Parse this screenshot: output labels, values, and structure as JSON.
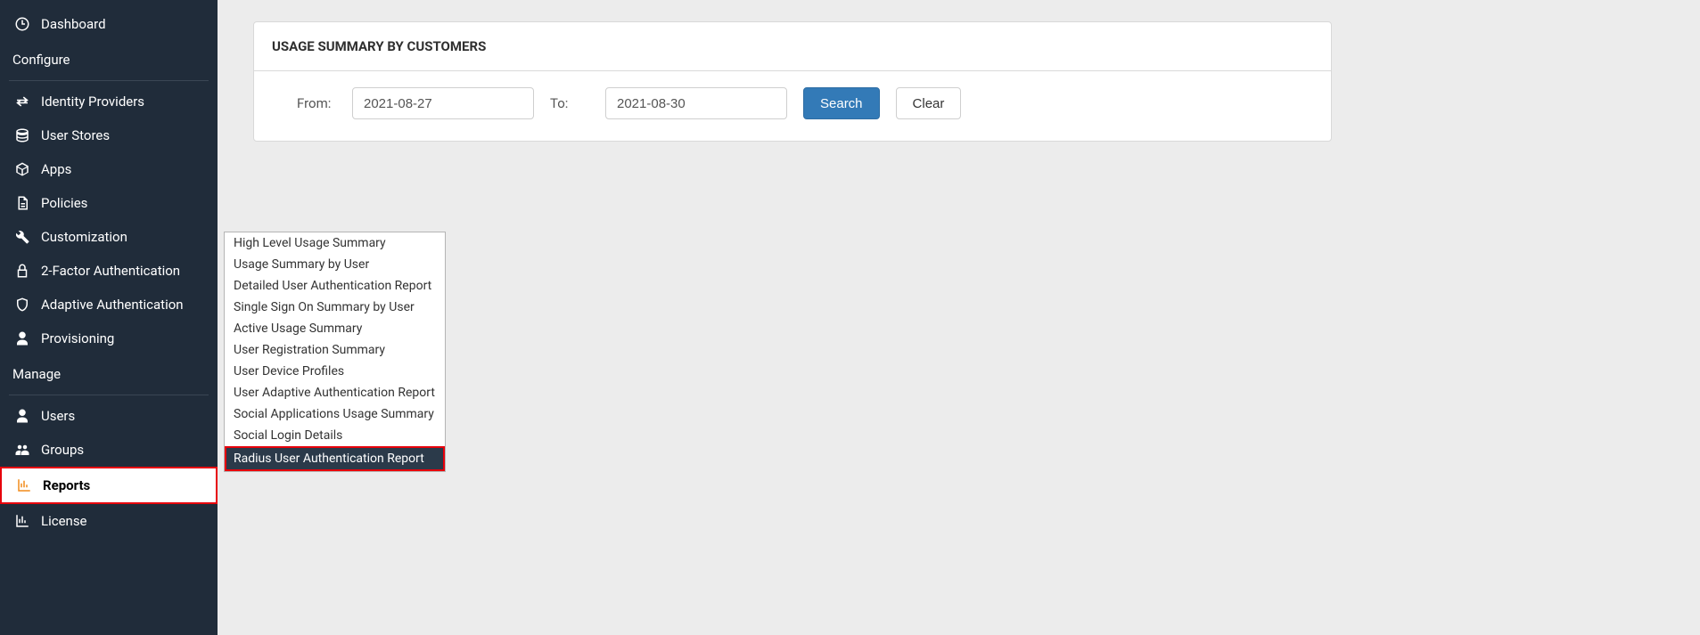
{
  "sidebar": {
    "dashboard": "Dashboard",
    "sections": {
      "configure": "Configure",
      "manage": "Manage"
    },
    "items": {
      "identity_providers": "Identity Providers",
      "user_stores": "User Stores",
      "apps": "Apps",
      "policies": "Policies",
      "customization": "Customization",
      "two_factor": "2-Factor Authentication",
      "adaptive": "Adaptive Authentication",
      "provisioning": "Provisioning",
      "users": "Users",
      "groups": "Groups",
      "reports": "Reports",
      "license": "License"
    }
  },
  "submenu": {
    "items": [
      "High Level Usage Summary",
      "Usage Summary by User",
      "Detailed User Authentication Report",
      "Single Sign On Summary by User",
      "Active Usage Summary",
      "User Registration Summary",
      "User Device Profiles",
      "User Adaptive Authentication Report",
      "Social Applications Usage Summary",
      "Social Login Details",
      "Radius User Authentication Report"
    ]
  },
  "panel": {
    "title": "USAGE SUMMARY BY CUSTOMERS",
    "from_label": "From:",
    "to_label": "To:",
    "from_value": "2021-08-27",
    "to_value": "2021-08-30",
    "search_label": "Search",
    "clear_label": "Clear"
  }
}
